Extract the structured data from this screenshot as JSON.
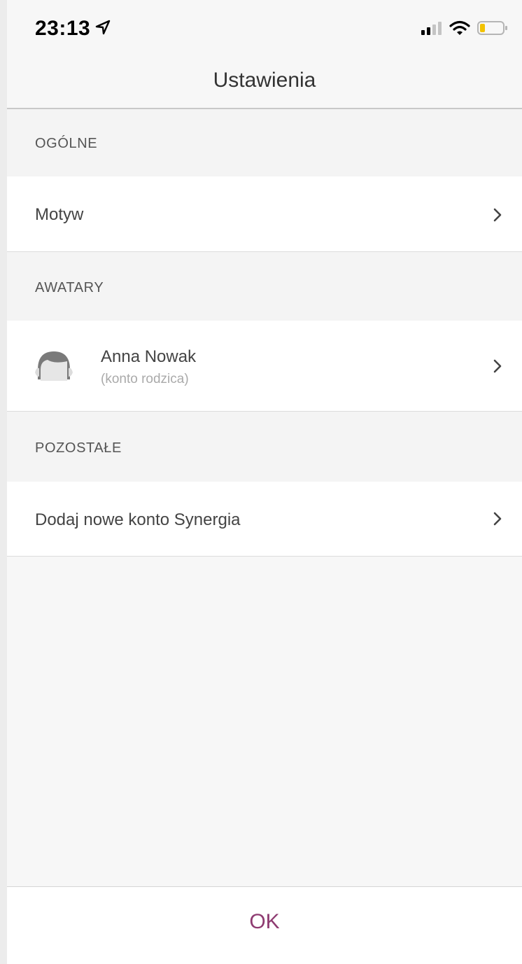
{
  "status_bar": {
    "time": "23:13",
    "icons": [
      "location-arrow-icon",
      "cellular-signal-icon",
      "wifi-icon",
      "battery-low-icon"
    ],
    "battery_color": "#f2c200"
  },
  "header": {
    "title": "Ustawienia"
  },
  "sections": {
    "general": {
      "label": "OGÓLNE",
      "items": [
        {
          "label": "Motyw"
        }
      ]
    },
    "avatars": {
      "label": "AWATARY",
      "items": [
        {
          "name": "Anna Nowak",
          "subtitle": "(konto rodzica)",
          "icon": "avatar-icon"
        }
      ]
    },
    "other": {
      "label": "POZOSTAŁE",
      "items": [
        {
          "label": "Dodaj nowe konto Synergia"
        }
      ]
    }
  },
  "footer": {
    "ok_label": "OK",
    "accent_color": "#8e3b71"
  }
}
